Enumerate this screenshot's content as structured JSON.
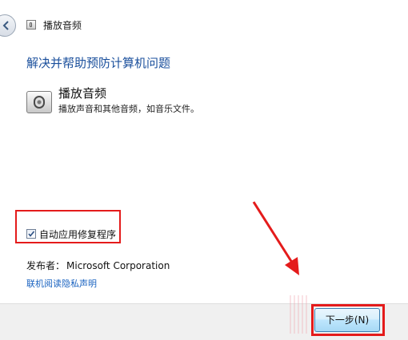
{
  "window": {
    "title": "播放音频"
  },
  "main": {
    "heading": "解决并帮助预防计算机问题",
    "tool_name": "播放音频",
    "tool_description": "播放声音和其他音频，如音乐文件。"
  },
  "options": {
    "auto_apply_label": "自动应用修复程序",
    "auto_apply_checked": true
  },
  "publisher": {
    "label": "发布者：",
    "value": "Microsoft Corporation"
  },
  "privacy_link": "联机阅读隐私声明",
  "footer": {
    "next_label": "下一步(N)"
  },
  "colors": {
    "annotation_red": "#e41b1b",
    "heading_blue": "#1a4f9c",
    "link_blue": "#1a63c0"
  },
  "icons": [
    "back-arrow-icon",
    "troubleshooter-icon",
    "speaker-icon",
    "checkmark-icon"
  ]
}
